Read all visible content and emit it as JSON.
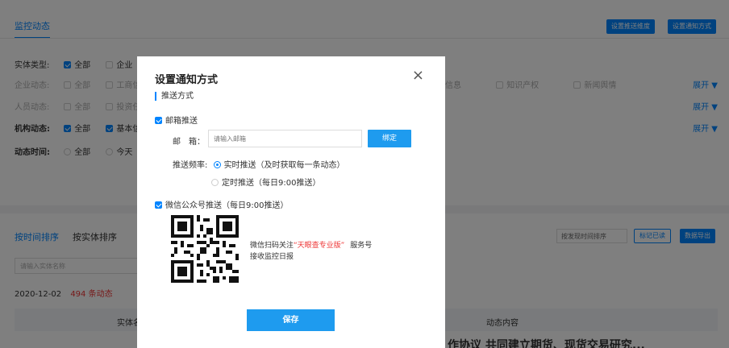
{
  "background": {
    "tab_label": "监控动态",
    "btn_push_dimension": "设置推送维度",
    "btn_notify_method": "设置通知方式",
    "filters": [
      {
        "label": "实体类型:",
        "options": [
          "全部",
          "企业"
        ]
      },
      {
        "label": "企业动态:",
        "options": [
          "全部",
          "工商信",
          "信息",
          "知识产权",
          "新闻舆情"
        ]
      },
      {
        "label": "人员动态:",
        "options": [
          "全部",
          "投资任"
        ]
      },
      {
        "label": "机构动态:",
        "options": [
          "全部",
          "基本信"
        ]
      },
      {
        "label": "动态时间:",
        "options": [
          "全部",
          "今天"
        ]
      }
    ],
    "expand_label": "展开 ▼",
    "sort_by_time": "按时间排序",
    "sort_by_entity": "按实体排序",
    "search_placeholder": "请输入实体名称",
    "sort_select_value": "按发现时间排序",
    "btn_mark_read": "标记已读",
    "btn_export": "数据导出",
    "date": "2020-12-02",
    "count": "494 条动态",
    "col_entity": "实体名",
    "col_content": "动态内容",
    "overflow_text": "作协议 共同建立期货、现货交易研究..."
  },
  "modal": {
    "title": "设置通知方式",
    "close_icon": "×",
    "section_title": "推送方式",
    "email_checkbox_label": "邮箱推送",
    "email_label": "邮　箱：",
    "email_placeholder": "请输入邮箱",
    "bind_button": "绑定",
    "freq_label": "推送频率:",
    "freq_realtime": "实时推送（及时获取每一条动态）",
    "freq_scheduled": "定时推送（每日9:00推送）",
    "wechat_checkbox_label": "微信公众号推送（每日9:00推送）",
    "qr_line1_prefix": "微信扫码关注",
    "qr_line1_highlight": "“天眼查专业版”",
    "qr_line1_suffix": "服务号",
    "qr_line2": "接收监控日报",
    "save_button": "保存"
  },
  "colors": {
    "accent": "#0084ff",
    "button": "#1e9bef",
    "highlight": "#e33333"
  }
}
